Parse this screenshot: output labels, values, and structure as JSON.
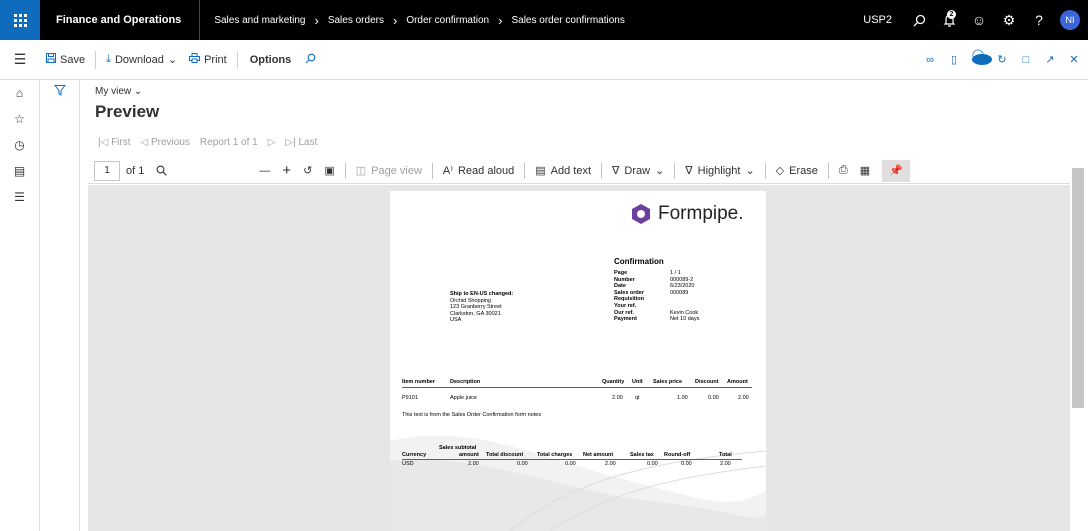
{
  "topbar": {
    "app_name": "Finance and Operations",
    "breadcrumbs": [
      "Sales and marketing",
      "Sales orders",
      "Order confirmation",
      "Sales order confirmations"
    ],
    "company": "USP2",
    "user_initials": "NI",
    "notification_count": "2"
  },
  "actions": {
    "save": "Save",
    "download": "Download",
    "print": "Print",
    "options": "Options",
    "notification_count": "0"
  },
  "header": {
    "view": "My view",
    "title": "Preview"
  },
  "report_nav": {
    "first": "First",
    "previous": "Previous",
    "report": "Report 1 of 1",
    "last": "Last"
  },
  "viewer": {
    "page_number": "1",
    "page_total": "of 1",
    "page_view": "Page view",
    "read_aloud": "Read aloud",
    "add_text": "Add text",
    "draw": "Draw",
    "highlight": "Highlight",
    "erase": "Erase"
  },
  "document": {
    "logo_text": "Formpipe.",
    "title": "Confirmation",
    "meta": [
      {
        "k": "Page",
        "v": "1 / 1"
      },
      {
        "k": "Number",
        "v": "000089-2"
      },
      {
        "k": "Date",
        "v": "6/23/2020"
      },
      {
        "k": "Sales order",
        "v": "000089"
      },
      {
        "k": "Requisition",
        "v": ""
      },
      {
        "k": "Your ref.",
        "v": ""
      },
      {
        "k": "Our ref.",
        "v": "Kevin Cook"
      },
      {
        "k": "Payment",
        "v": "Net 10 days"
      }
    ],
    "ship_to": {
      "heading": "Ship to EN-US changed:",
      "lines": [
        "Orchid Shopping",
        "123 Granberry Street",
        "Clarkston, GA 30021",
        "USA"
      ]
    },
    "lines_header": {
      "item": "Item number",
      "desc": "Description",
      "qty": "Quantity",
      "unit": "Unit",
      "price": "Sales price",
      "discount": "Discount",
      "amount": "Amount"
    },
    "line": {
      "item": "P9101",
      "desc": "Apple juice",
      "qty": "2.00",
      "unit": "qt",
      "price": "1.00",
      "discount": "0.00",
      "amount": "2.00"
    },
    "note": "This text is from the Sales Order Confirmation form notes",
    "totals_header": {
      "currency": "Currency",
      "subtotal_1": "Sales subtotal",
      "subtotal_2": "amount",
      "total_discount": "Total discount",
      "total_charges": "Total charges",
      "net_amount": "Net amount",
      "sales_tax": "Sales tax",
      "round_off": "Round-off",
      "total": "Total"
    },
    "totals": {
      "currency": "USD",
      "subtotal": "2.00",
      "total_discount": "0.00",
      "total_charges": "0.00",
      "net_amount": "2.00",
      "sales_tax": "0.00",
      "round_off": "0.00",
      "total": "2.00"
    }
  }
}
